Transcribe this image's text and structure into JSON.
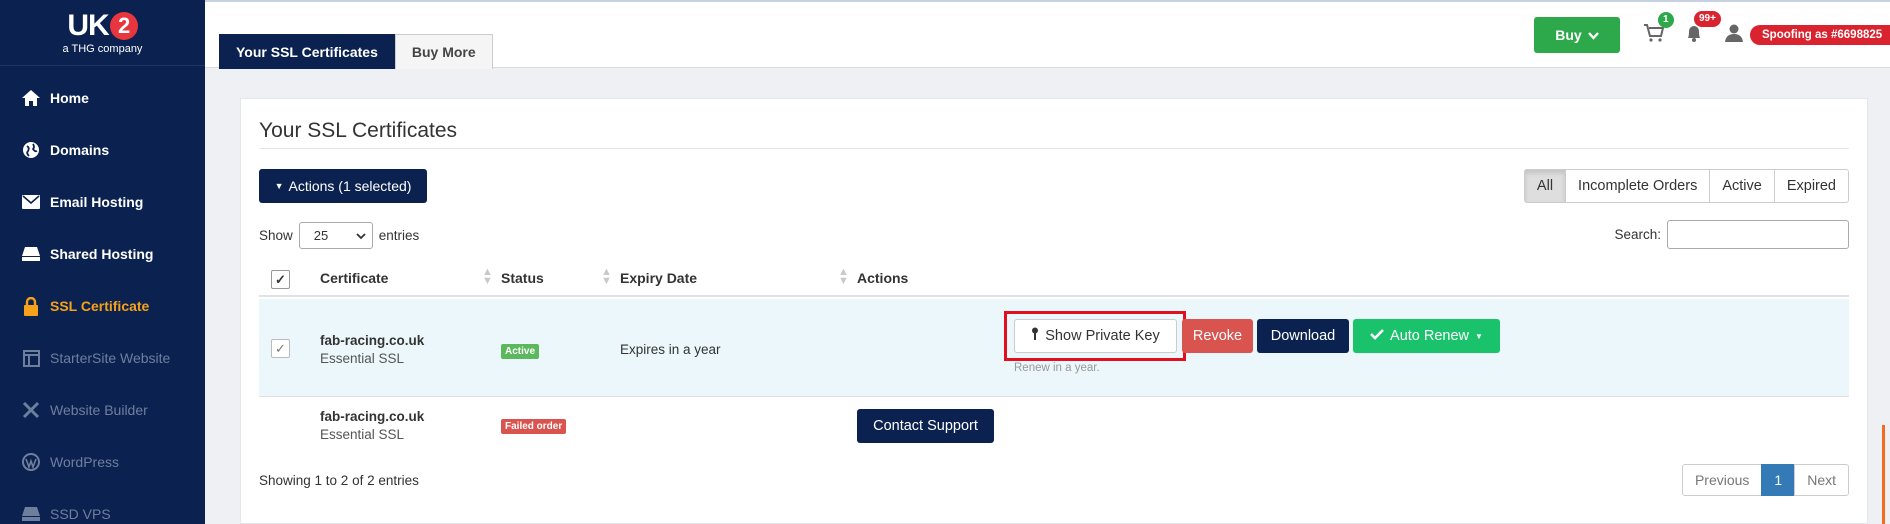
{
  "sidebar": {
    "logo": {
      "main": "UK",
      "digit": "2",
      "sub": "a THG company"
    },
    "items": [
      {
        "label": "Home",
        "icon": "home-icon"
      },
      {
        "label": "Domains",
        "icon": "globe-icon"
      },
      {
        "label": "Email Hosting",
        "icon": "envelope-icon"
      },
      {
        "label": "Shared Hosting",
        "icon": "server-icon"
      },
      {
        "label": "SSL Certificate",
        "icon": "lock-icon"
      },
      {
        "label": "StarterSite Website",
        "icon": "layout-icon"
      },
      {
        "label": "Website Builder",
        "icon": "tools-icon"
      },
      {
        "label": "WordPress",
        "icon": "wordpress-icon"
      },
      {
        "label": "SSD VPS",
        "icon": "server-icon"
      }
    ]
  },
  "topbar": {
    "tabs": [
      "Your SSL Certificates",
      "Buy More"
    ],
    "buy_label": "Buy",
    "cart_count": "1",
    "notif_count": "99+",
    "spoof_text": "Spoofing as #6698825"
  },
  "panel": {
    "title": "Your SSL Certificates",
    "actions_label": "Actions (1 selected)",
    "filters": [
      "All",
      "Incomplete Orders",
      "Active",
      "Expired"
    ],
    "show_label": "Show",
    "entries_label": "entries",
    "page_length": "25",
    "search_label": "Search:",
    "columns": [
      "Certificate",
      "Status",
      "Expiry Date",
      "Actions"
    ],
    "rows": [
      {
        "name": "fab-racing.co.uk",
        "type": "Essential SSL",
        "status": "Active",
        "expiry": "Expires in a year",
        "show_key_label": "Show Private Key",
        "revoke_label": "Revoke",
        "download_label": "Download",
        "auto_renew_label": "Auto Renew",
        "renew_note": "Renew in a year."
      },
      {
        "name": "fab-racing.co.uk",
        "type": "Essential SSL",
        "status": "Failed order",
        "expiry": "",
        "contact_label": "Contact Support"
      }
    ],
    "info": "Showing 1 to 2 of 2 entries",
    "pager": {
      "previous": "Previous",
      "current": "1",
      "next": "Next"
    }
  },
  "colors": {
    "navy": "#0b2250",
    "orange": "#f7a11a",
    "green": "#2da84a",
    "red": "#d9534f",
    "auto_renew": "#19c26b"
  }
}
